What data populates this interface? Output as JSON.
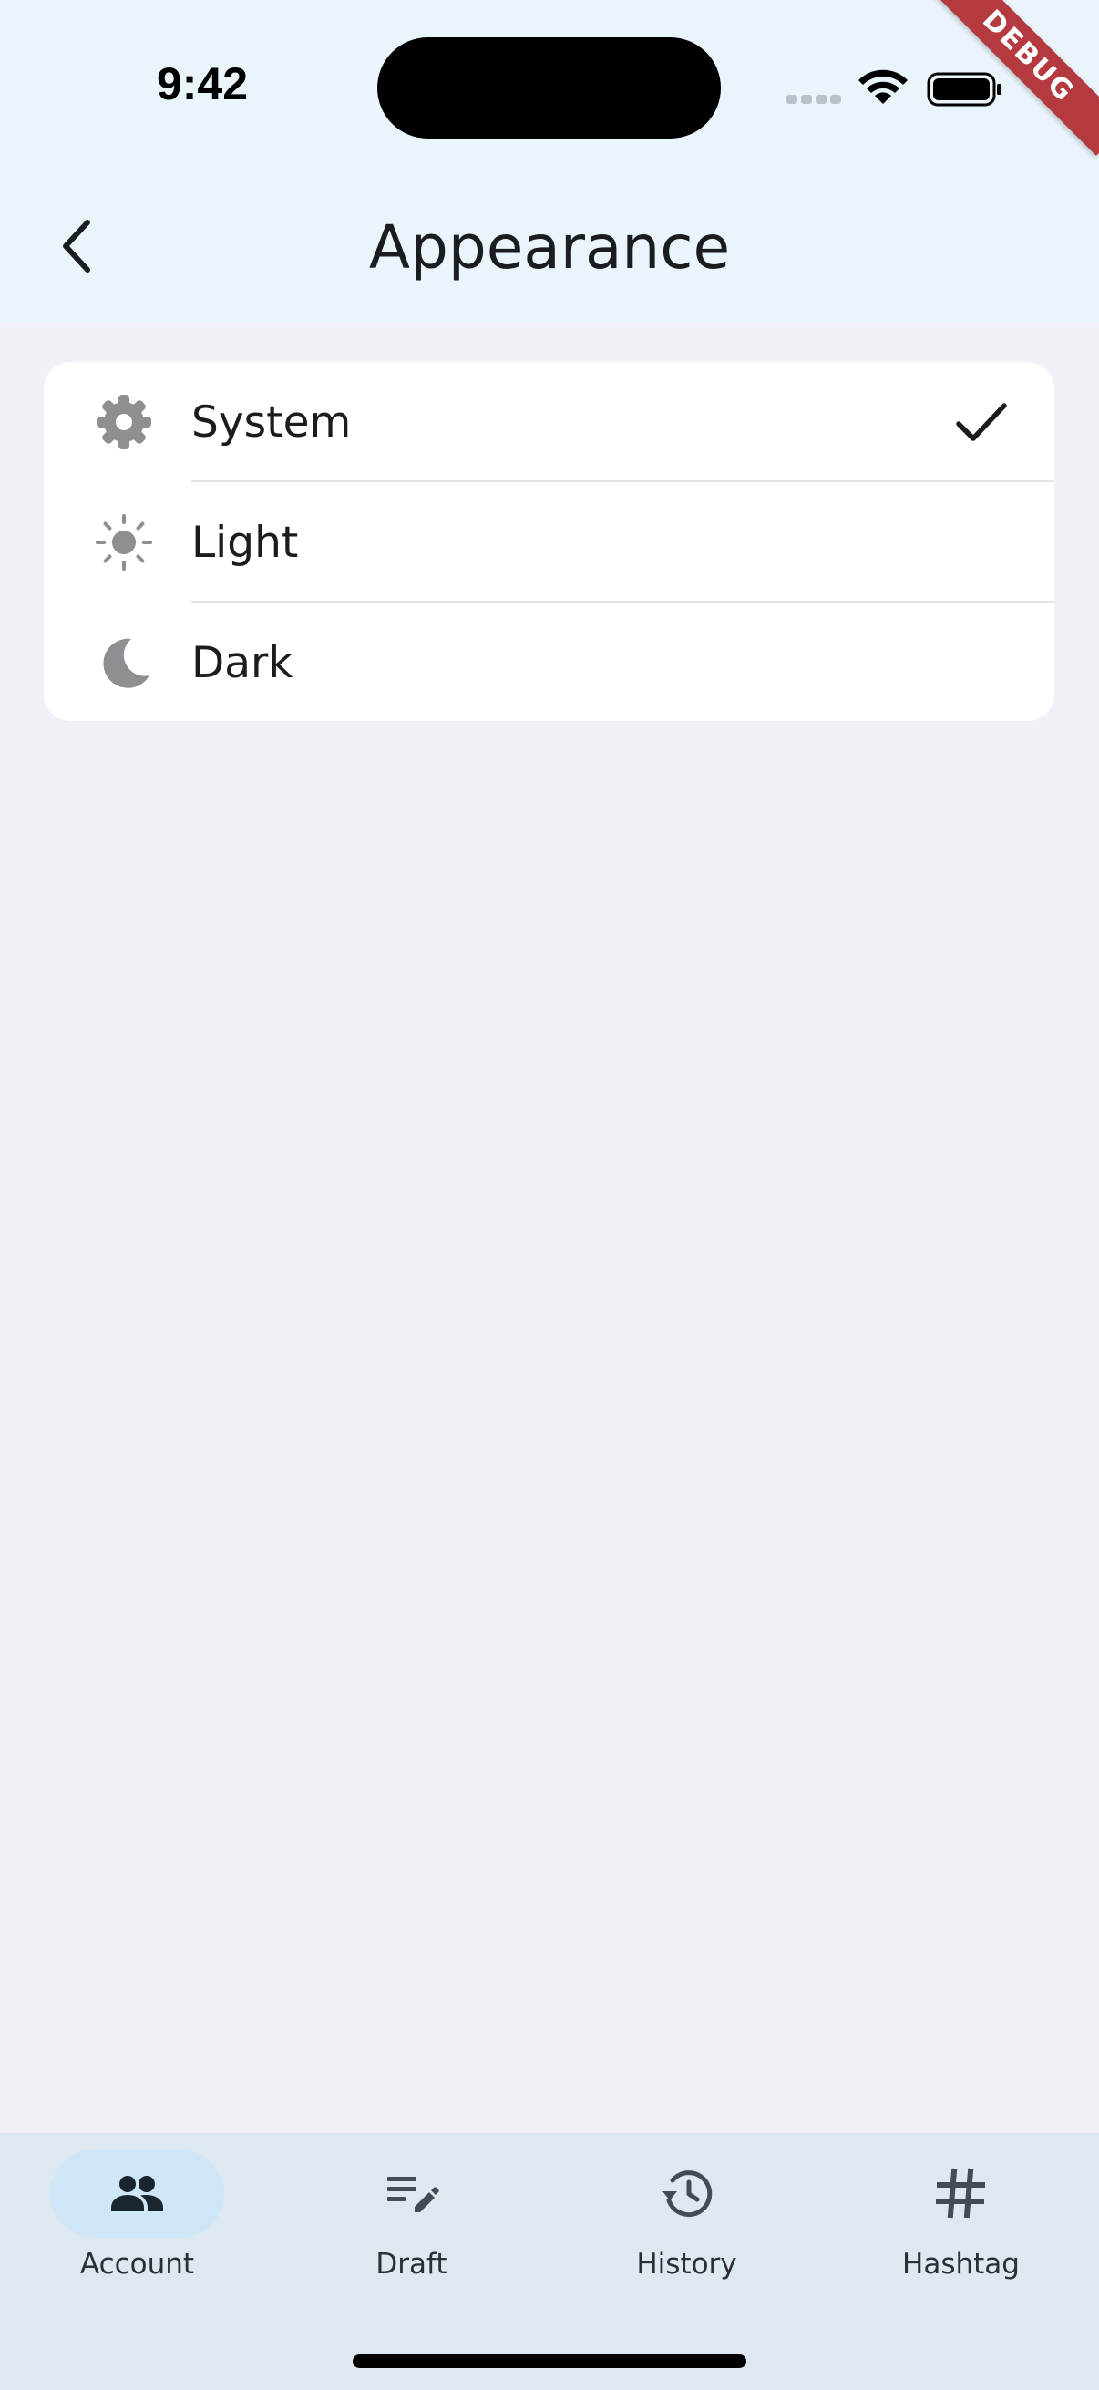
{
  "status_bar": {
    "time": "9:42",
    "icons": [
      "cell-signal-icon",
      "wifi-icon",
      "battery-icon"
    ]
  },
  "debug_banner": {
    "label": "DEBUG",
    "color": "#b53a3f"
  },
  "app_bar": {
    "back_icon": "chevron-left-icon",
    "title": "Appearance"
  },
  "appearance_options": [
    {
      "label": "System",
      "icon": "gear-icon",
      "selected": true
    },
    {
      "label": "Light",
      "icon": "sun-icon",
      "selected": false
    },
    {
      "label": "Dark",
      "icon": "moon-icon",
      "selected": false
    }
  ],
  "bottom_nav": {
    "items": [
      {
        "label": "Account",
        "icon": "people-icon",
        "active": true
      },
      {
        "label": "Draft",
        "icon": "edit-note-icon",
        "active": false
      },
      {
        "label": "History",
        "icon": "history-icon",
        "active": false
      },
      {
        "label": "Hashtag",
        "icon": "hashtag-icon",
        "active": false
      }
    ]
  },
  "colors": {
    "app_bar_background": "#e9f4fb",
    "page_background": "#f1f0f6",
    "card_background": "#ffffff",
    "nav_background": "#dde8f1",
    "nav_active_indicator": "#cfe6f7",
    "icon_gray": "#8e8e93",
    "text_primary": "#1b1c1f"
  }
}
